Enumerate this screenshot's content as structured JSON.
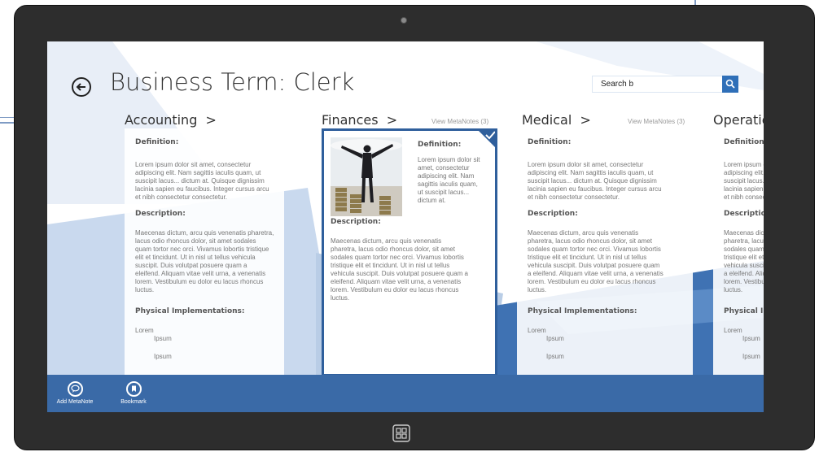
{
  "page": {
    "title": "Business Term: Clerk",
    "search_value": "Search b"
  },
  "columns": [
    {
      "heading": "Accounting",
      "chevron": ">",
      "view_notes": "",
      "definition_label": "Definition:",
      "definition_lines": [
        "Lorem ipsum dolor sit amet, consectetur",
        "adipiscing elit. Nam sagittis iaculis quam, ut",
        "suscipit lacus... dictum at. Quisque dignissim",
        "lacinia sapien eu faucibus. Integer cursus arcu",
        "et nibh consectetur consectetur."
      ],
      "description_label": "Description:",
      "description_lines": [
        "Maecenas dictum, arcu quis venenatis pharetra,",
        "lacus odio rhoncus dolor, sit amet sodales",
        "quam tortor nec orci. Vivamus lobortis tristique",
        "elit et tincidunt. Ut in nisl ut tellus vehicula",
        "suscipit. Duis volutpat posuere quam a",
        "eleifend. Aliquam vitae velit urna, a venenatis",
        "lorem. Vestibulum eu dolor eu lacus rhoncus",
        "luctus."
      ],
      "impl_label": "Physical Implementations:",
      "impl_root": "Lorem",
      "impl_items": [
        "Ipsum",
        "Ipsum"
      ]
    },
    {
      "heading": "Finances",
      "chevron": ">",
      "view_notes": "View MetaNotes (3)",
      "definition_label": "Definition:",
      "definition_lines": [
        "Lorem ipsum dolor sit",
        "amet, consectetur",
        "adipiscing elit. Nam",
        "sagittis iaculis quam,",
        "ut suscipit lacus...",
        "dictum at."
      ],
      "description_label": "Description:",
      "description_lines": [
        "Maecenas dictum, arcu quis venenatis",
        "pharetra, lacus odio rhoncus dolor, sit amet",
        "sodales quam tortor nec orci. Vivamus lobortis",
        "tristique elit et tincidunt. Ut in nisl ut tellus",
        "vehicula suscipit. Duis volutpat posuere quam a",
        "eleifend. Aliquam vitae velit urna, a venenatis",
        "lorem. Vestibulum eu dolor eu lacus rhoncus",
        "luctus."
      ]
    },
    {
      "heading": "Medical",
      "chevron": ">",
      "view_notes": "View MetaNotes (3)",
      "definition_label": "Definition:",
      "definition_lines": [
        "Lorem ipsum dolor sit amet, consectetur",
        "adipiscing elit. Nam sagittis iaculis quam, ut",
        "suscipit lacus... dictum at. Quisque dignissim",
        "lacinia sapien eu faucibus. Integer cursus arcu",
        "et nibh consectetur consectetur."
      ],
      "description_label": "Description:",
      "description_lines": [
        "Maecenas dictum, arcu quis venenatis",
        "pharetra, lacus odio rhoncus dolor, sit amet",
        "sodales quam tortor nec orci. Vivamus lobortis",
        "tristique elit et tincidunt. Ut in nisl ut tellus",
        "vehicula suscipit. Duis volutpat posuere quam",
        "a eleifend. Aliquam vitae velit urna, a venenatis",
        "lorem. Vestibulum eu dolor eu lacus rhoncus",
        "luctus."
      ],
      "impl_label": "Physical Implementations:",
      "impl_root": "Lorem",
      "impl_items": [
        "Ipsum",
        "Ipsum"
      ]
    },
    {
      "heading": "Operations",
      "chevron": "",
      "view_notes": "",
      "definition_label": "Definition:",
      "definition_lines": [
        "Lorem ipsum dolor sit amet, consectetur",
        "adipiscing elit. Nam sagittis iaculis quam, ut",
        "suscipit lacus... dictum at. Quisque dignissim",
        "lacinia sapien eu faucibus. Integer cursus arcu",
        "et nibh consectetur consectetur."
      ],
      "description_label": "Description:",
      "description_lines": [
        "Maecenas dictum, arcu quis venenatis",
        "pharetra, lacus odio rhoncus dolor, sit amet",
        "sodales quam tortor nec orci. Vivamus lobortis",
        "tristique elit et tincidunt. Ut in nisl ut tellus",
        "vehicula suscipit. Duis volutpat posuere quam",
        "a eleifend. Aliquam vitae velit urna, a venenatis",
        "lorem. Vestibulum eu dolor eu lacus rhoncus",
        "luctus."
      ],
      "impl_label": "Physical Implementations:",
      "impl_root": "Lorem",
      "impl_items": [
        "Ipsum",
        "Ipsum"
      ]
    }
  ],
  "appbar": {
    "add_metanote_label": "Add MetaNote",
    "bookmark_label": "Bookmark"
  },
  "colors": {
    "accent": "#3a6aa7",
    "search_button": "#2f6fb8",
    "bezel": "#2d2d2d",
    "selected_border": "#2f5f9c"
  },
  "icons": {
    "back": "back-arrow-icon",
    "search": "search-icon",
    "selected": "checkmark-icon",
    "add_metanote": "add-metanote-icon",
    "bookmark": "bookmark-icon",
    "windows": "windows-logo-icon"
  }
}
